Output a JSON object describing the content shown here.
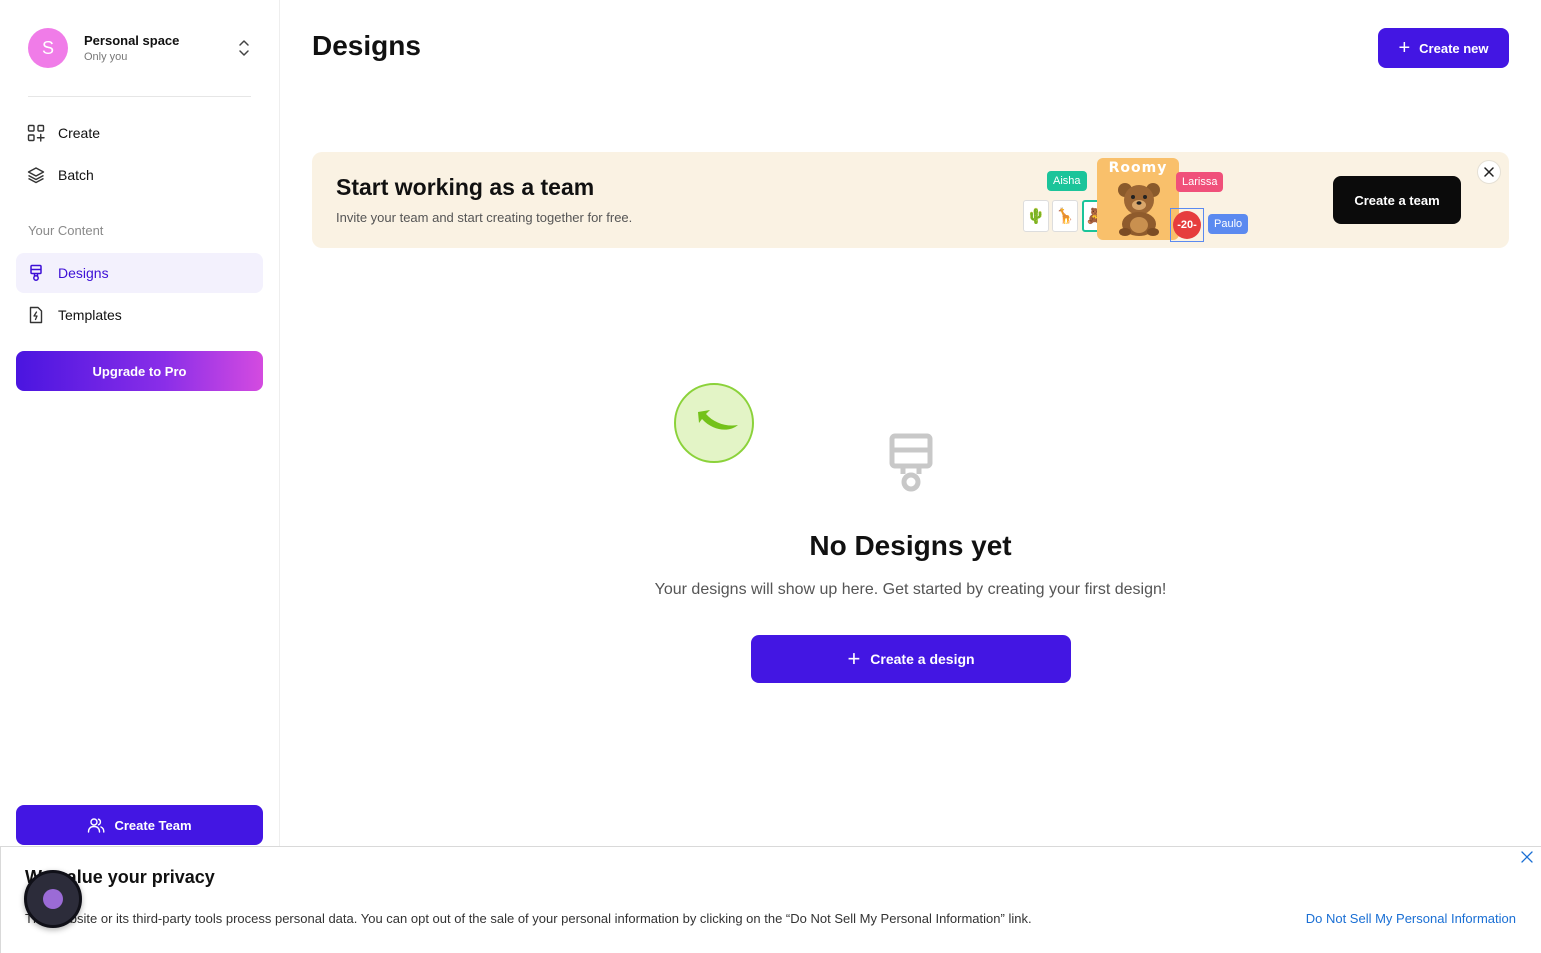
{
  "workspace": {
    "avatar_letter": "S",
    "name": "Personal space",
    "subtitle": "Only you"
  },
  "sidebar": {
    "items": [
      {
        "label": "Create",
        "icon": "create-grid-icon"
      },
      {
        "label": "Batch",
        "icon": "layers-icon"
      }
    ],
    "section_label": "Your Content",
    "content_items": [
      {
        "label": "Designs",
        "icon": "brush-icon",
        "active": true
      },
      {
        "label": "Templates",
        "icon": "template-file-icon",
        "active": false
      }
    ],
    "upgrade_label": "Upgrade to Pro",
    "create_team_label": "Create Team"
  },
  "header": {
    "title": "Designs",
    "create_new_label": "Create new"
  },
  "banner": {
    "title": "Start working as a team",
    "subtitle": "Invite your team and start creating together for free.",
    "button_label": "Create a team",
    "illustration": {
      "tags": [
        "Aisha",
        "Larissa",
        "Paulo"
      ],
      "poster_title": "Roomy",
      "sale_badge": "-20-"
    }
  },
  "empty_state": {
    "title": "No Designs yet",
    "subtitle": "Your designs will show up here. Get started by creating your first design!",
    "button_label": "Create a design"
  },
  "privacy": {
    "title": "We value your privacy",
    "text": "This website or its third-party tools process personal data. You can opt out of the sale of your personal information by clicking on the “Do Not Sell My Personal Information” link.",
    "link_label": "Do Not Sell My Personal Information"
  },
  "colors": {
    "primary": "#4316e3",
    "active_bg": "#f3f1fd",
    "banner_bg": "#faf2e3",
    "avatar": "#f07ce8",
    "link": "#1a6fd4"
  }
}
